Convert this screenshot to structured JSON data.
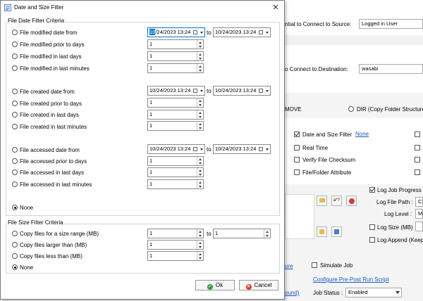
{
  "background": {
    "source_credential_label": "ntial to Connect to Source:",
    "source_credential_value": "Logged in User",
    "dest_credential_label": "o Connect to Destination:",
    "dest_credential_value": "wasabi",
    "move_label": "MOVE",
    "dir_label": "DIR (Copy Folder Structure",
    "options": {
      "date_size_filter": "Date and Size Filter",
      "date_size_filter_link": "None",
      "real_time": "Real Time",
      "verify_checksum": "Verify File Checksum",
      "file_folder_attribute": "File/Folder Attribute"
    },
    "log": {
      "log_job_progress": "Log Job Progress",
      "log_file_path_label": "Log File Path :",
      "log_file_path_value": "C:",
      "log_level_label": "Log Level :",
      "log_level_value": "M",
      "log_size_label": "Log Size (MB)",
      "log_append_label": "Log Append (Keep"
    },
    "filter_btn_labels": [
      "a*?"
    ],
    "fragment_ure": "ure",
    "fragment_ound": "ound)",
    "simulate_job": "Simulate Job",
    "configure_link": "Configure Pre-Post Run Script",
    "job_status_label": "Job Status :",
    "job_status_value": "Enabled"
  },
  "dialog": {
    "title": "Date and Size Filter",
    "close_glyph": "✕",
    "date_section_title": "File Date Filter Criteria",
    "to_label": "to",
    "modified": {
      "date_label": "File modified date from",
      "from_value": "10/24/2023 13:24",
      "from_selected_part": "10",
      "from_rest": "/24/2023 13:24",
      "to_value": "10/24/2023 13:24",
      "prior_label": "File modified prior to days",
      "prior_value": "1",
      "last_days_label": "File modified in last days",
      "last_days_value": "1",
      "last_minutes_label": "File modified in last minutes",
      "last_minutes_value": "1"
    },
    "created": {
      "date_label": "File created date from",
      "from_value": "10/24/2023 13:24",
      "to_value": "10/24/2023 13:24",
      "prior_label": "File created prior to days",
      "prior_value": "1",
      "last_days_label": "File created in last days",
      "last_days_value": "1",
      "last_minutes_label": "File created in last minutes",
      "last_minutes_value": "1"
    },
    "accessed": {
      "date_label": "File accessed date from",
      "from_value": "10/24/2023 13:24",
      "to_value": "10/24/2023 13:24",
      "prior_label": "File accessed prior to days",
      "prior_value": "1",
      "last_days_label": "File accessed in last days",
      "last_days_value": "1",
      "last_minutes_label": "File accessed in last minutes",
      "last_minutes_value": "1"
    },
    "date_none_label": "None",
    "size_section_title": "File Size Filter Criteria",
    "size": {
      "range_label": "Copy files for a size range  (MB)",
      "range_from": "1",
      "range_to": "1",
      "larger_label": "Copy files larger than  (MB)",
      "larger_value": "1",
      "less_label": "Copy files less than  (MB)",
      "less_value": "1",
      "none_label": "None"
    },
    "ok_label": "Ok",
    "cancel_label": "Cancel"
  },
  "colors": {
    "accent": "#0078d7",
    "link": "#1a56c4",
    "ok_icon": "#2e9e3a",
    "cancel_icon": "#d83a2a"
  }
}
